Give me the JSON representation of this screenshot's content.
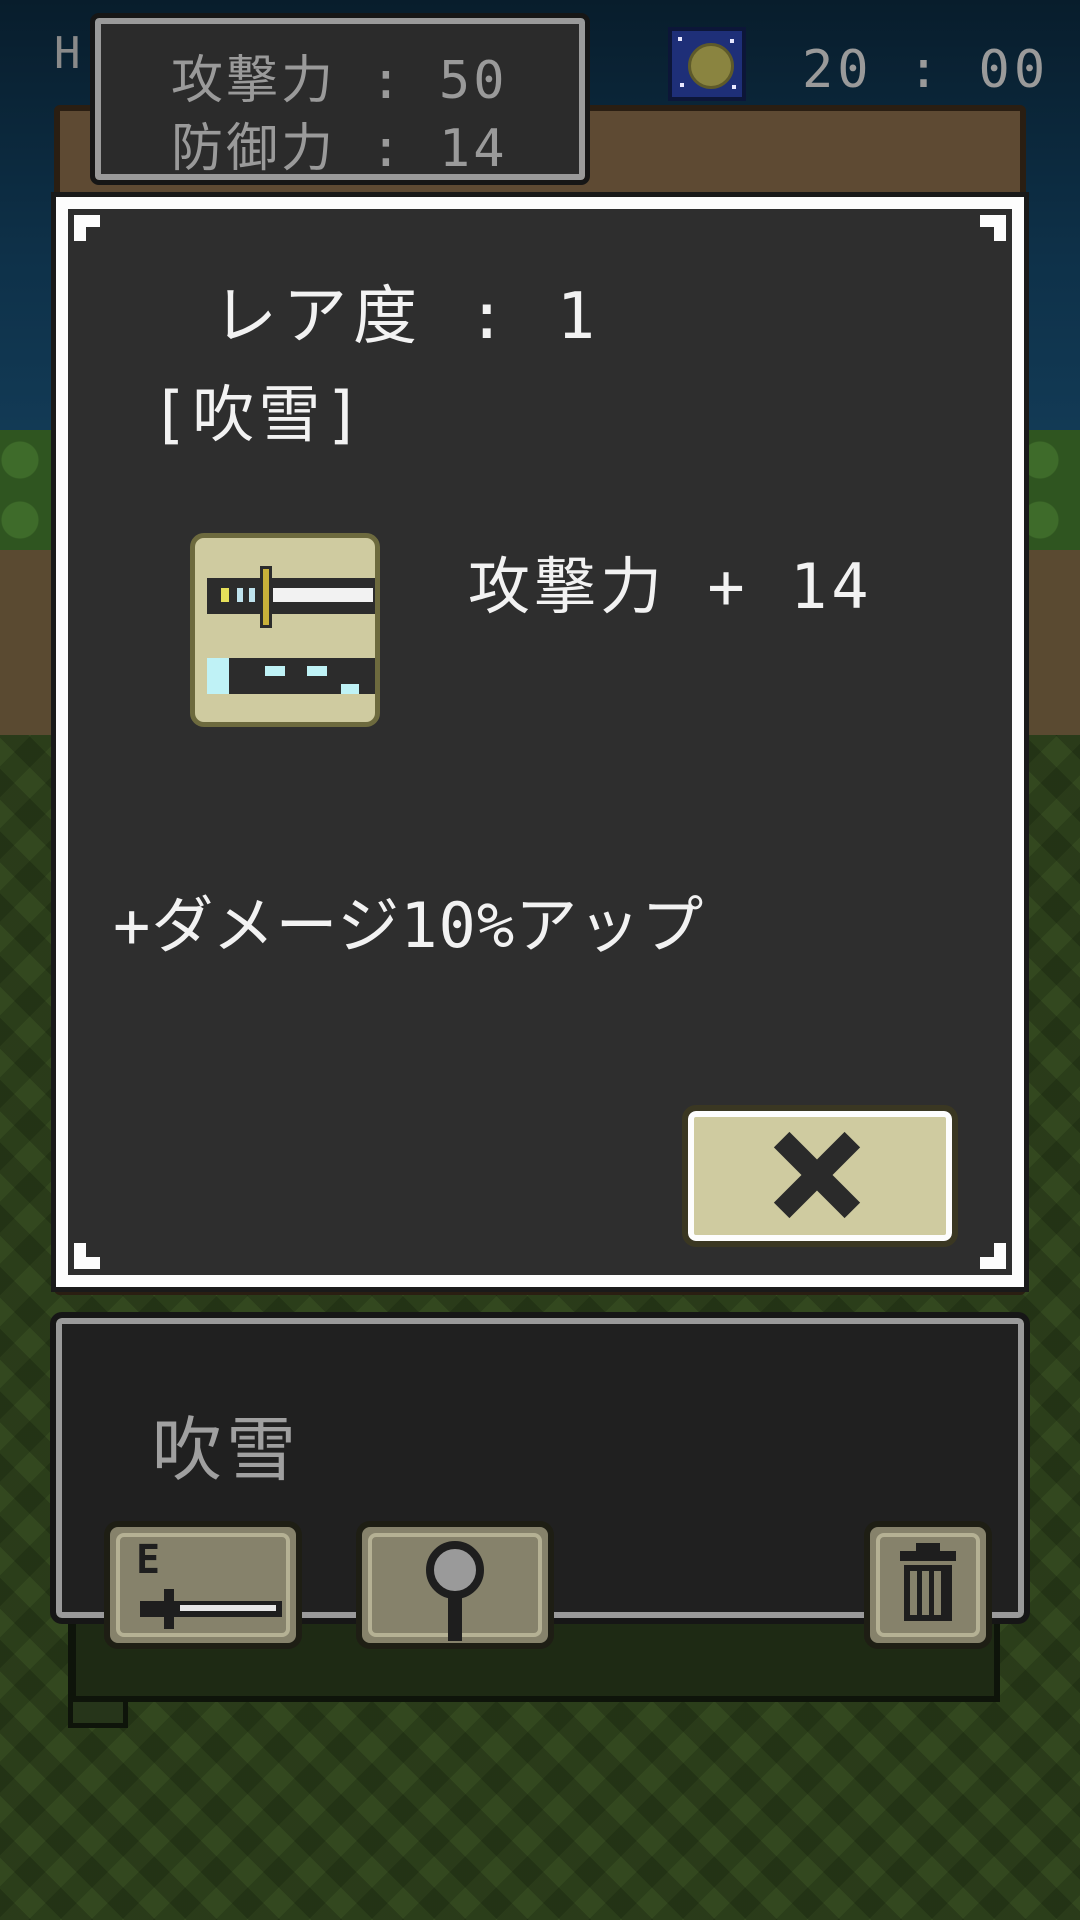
{
  "hud": {
    "left_letter": "H",
    "stats": {
      "attack": "攻撃力 : 50",
      "defense": "防御力 : 14"
    },
    "time": "20 : 00",
    "time_icon": "moon-night-icon"
  },
  "item_detail": {
    "rarity": "レア度 : 1",
    "name": "[吹雪]",
    "icon": "ice-sword-icon",
    "attack_bonus": "攻撃力 + 14",
    "effect": "+ダメージ10%アップ",
    "close_icon": "close-x-icon"
  },
  "inventory": {
    "selected_name": "吹雪",
    "buttons": {
      "equip_icon": "equip-sword-icon",
      "equip_label": "E",
      "inspect_icon": "magnifier-icon",
      "delete_icon": "trash-icon"
    }
  },
  "colors": {
    "panel_dark": "#2e2e2e",
    "panel_border": "#fdfdfd",
    "button_beige": "#cfcba0",
    "wood": "#5e4a33",
    "text_light": "#f2f2f2"
  }
}
